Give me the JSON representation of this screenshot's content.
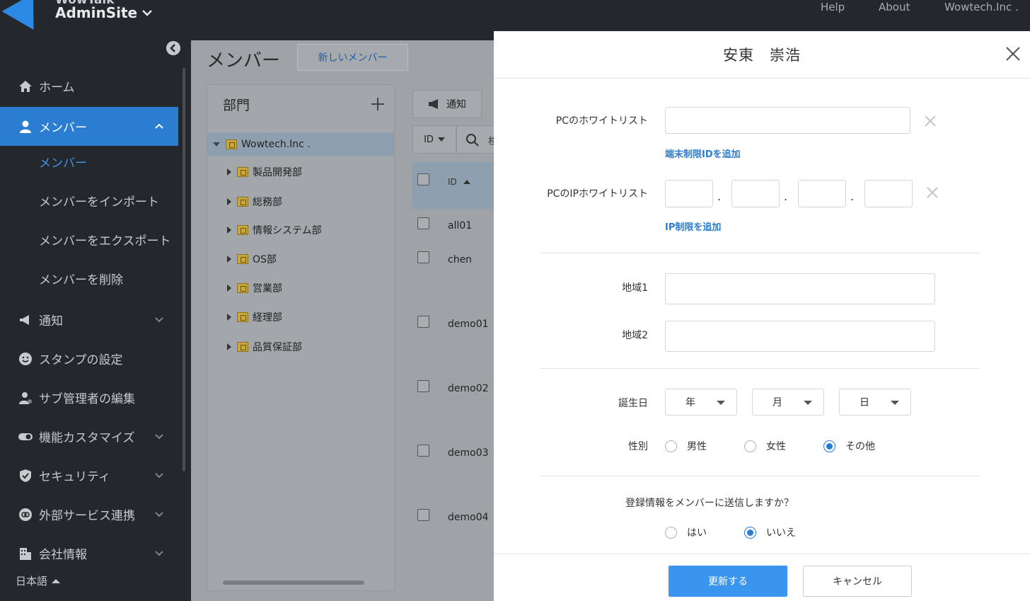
{
  "app": {
    "brand_top": "WowTalk",
    "brand": "AdminSite",
    "top_links": [
      "Help",
      "About",
      "Wowtech.Inc ."
    ]
  },
  "sidebar": {
    "items": [
      {
        "label": "ホーム",
        "icon": "home-icon"
      },
      {
        "label": "メンバー",
        "icon": "person-icon",
        "active": true
      },
      {
        "label": "通知",
        "icon": "megaphone-icon"
      },
      {
        "label": "スタンプの設定",
        "icon": "smile-icon"
      },
      {
        "label": "サブ管理者の編集",
        "icon": "person-gear-icon"
      },
      {
        "label": "機能カスタマイズ",
        "icon": "toggle-icon"
      },
      {
        "label": "セキュリティ",
        "icon": "shield-icon"
      },
      {
        "label": "外部サービス連携",
        "icon": "link-icon"
      },
      {
        "label": "会社情報",
        "icon": "building-icon"
      }
    ],
    "sub_items": [
      "メンバー",
      "メンバーをインポート",
      "メンバーをエクスポート",
      "メンバーを削除"
    ],
    "language": "日本語"
  },
  "main": {
    "title": "メンバー",
    "new_member_button": "新しいメンバー",
    "dept_panel": {
      "title": "部門",
      "root": "Wowtech.Inc .",
      "children": [
        "製品開発部",
        "総務部",
        "情報システム部",
        "OS部",
        "営業部",
        "経理部",
        "品質保証部"
      ]
    },
    "toolbar": {
      "notify": "通知",
      "sort": "ID",
      "search_placeholder": "検"
    },
    "table": {
      "header_id": "ID",
      "rows": [
        "all01",
        "chen",
        "demo01",
        "demo02",
        "demo03",
        "demo04"
      ]
    }
  },
  "dialog": {
    "title": "安東　崇浩",
    "pc_whitelist_label": "PCのホワイトリスト",
    "pc_whitelist_value": "",
    "add_device_id_link": "端末制限IDを追加",
    "ip_whitelist_label": "PCのIPホワイトリスト",
    "ip_octets": [
      "",
      "",
      "",
      ""
    ],
    "add_ip_link": "IP制限を追加",
    "region1_label": "地域1",
    "region1_value": "",
    "region2_label": "地域2",
    "region2_value": "",
    "birthday_label": "誕生日",
    "birthday": {
      "year": "年",
      "month": "月",
      "day": "日"
    },
    "gender_label": "性別",
    "gender_options": [
      "男性",
      "女性",
      "その他"
    ],
    "gender_selected": "その他",
    "send_question": "登録情報をメンバーに送信しますか？",
    "send_options": [
      "はい",
      "いいえ"
    ],
    "send_selected": "いいえ",
    "update_button": "更新する",
    "cancel_button": "キャンセル"
  },
  "colors": {
    "accent": "#2b7dd1",
    "sidebar_bg": "#24272b",
    "primary_button": "#3a95ee"
  }
}
